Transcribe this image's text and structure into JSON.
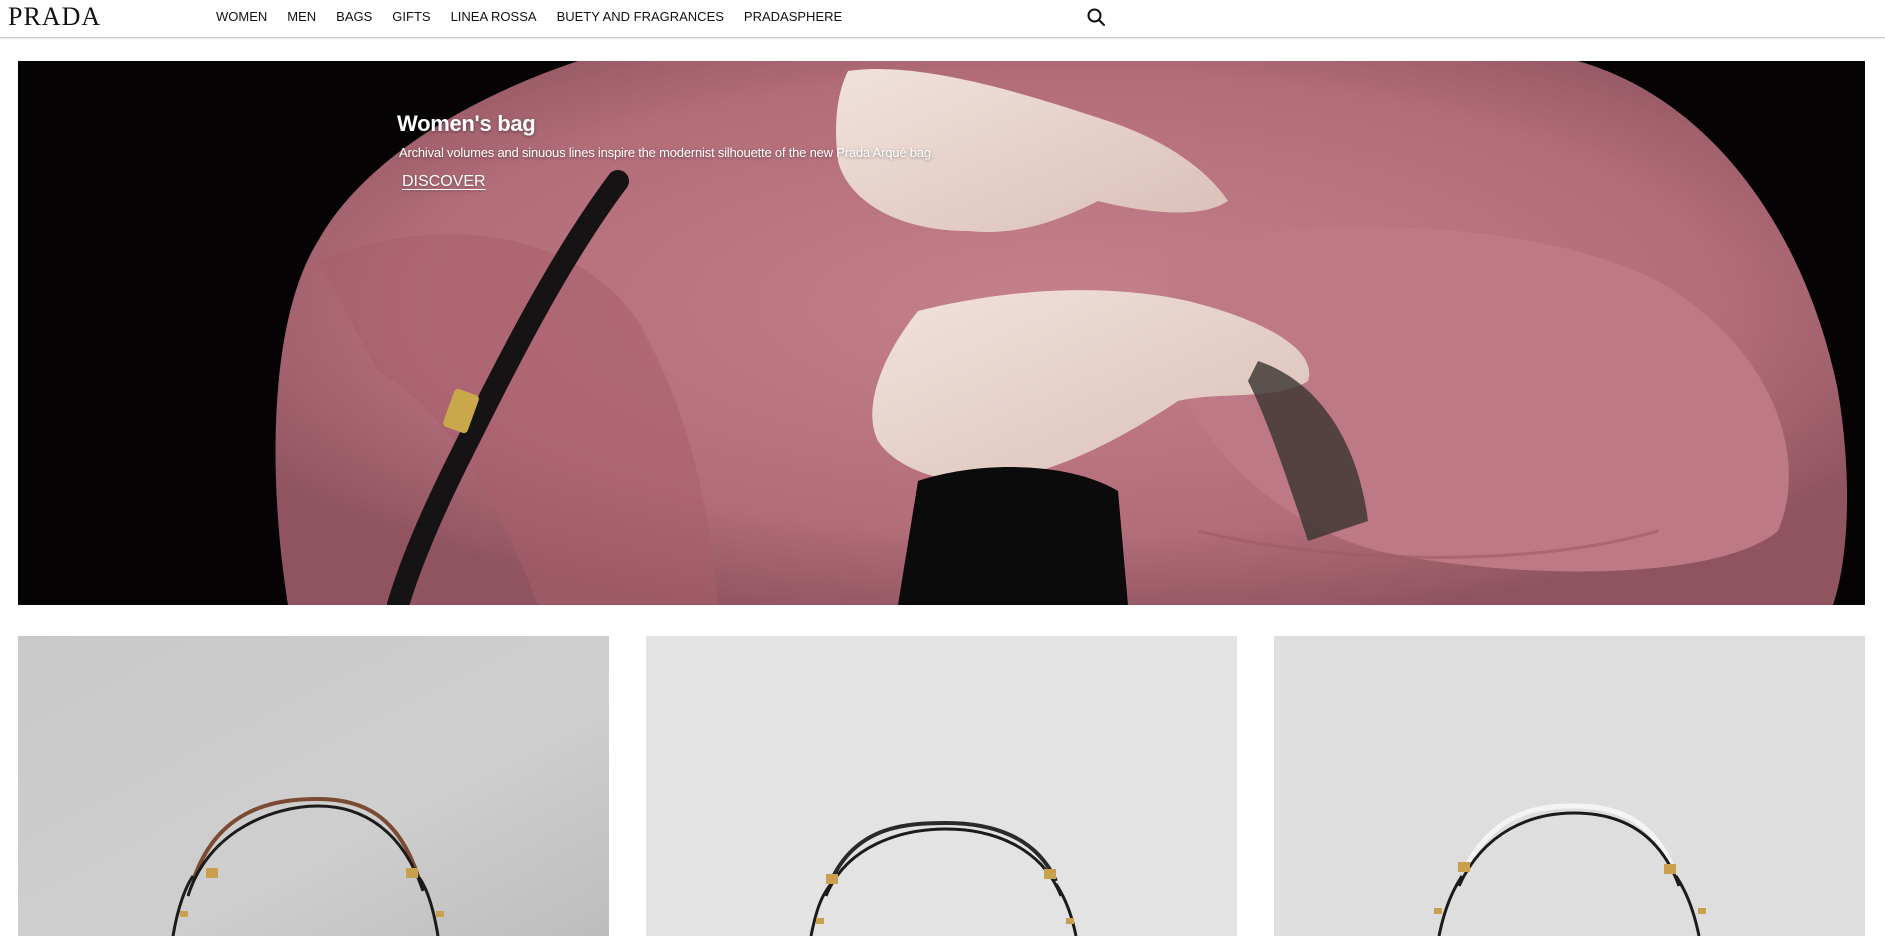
{
  "brand": {
    "logo_text": "PRADA"
  },
  "nav": {
    "items": [
      {
        "label": "WOMEN"
      },
      {
        "label": "MEN"
      },
      {
        "label": "BAGS"
      },
      {
        "label": "GIFTS"
      },
      {
        "label": "LINEA ROSSA"
      },
      {
        "label": "BUETY AND FRAGRANCES"
      },
      {
        "label": "PRADASPHERE"
      }
    ],
    "search_icon": "search-icon"
  },
  "hero": {
    "title": "Women's bag",
    "subtitle": "Archival volumes and sinuous lines inspire the modernist silhouette of the new Prada Arqué bag.",
    "cta_label": "DISCOVER",
    "colors": {
      "coat": "#b7727e",
      "background": "#050303",
      "text": "#ffffff"
    }
  },
  "products": [
    {
      "image": "bag-with-brown-handle",
      "background": "#cdcdcd",
      "handle_color": "#7a4a32"
    },
    {
      "image": "bag-with-black-handle",
      "background": "#e3e3e3",
      "handle_color": "#2a2a2a"
    },
    {
      "image": "bag-with-white-handle",
      "background": "#dedede",
      "handle_color": "#f2f2f2"
    }
  ]
}
